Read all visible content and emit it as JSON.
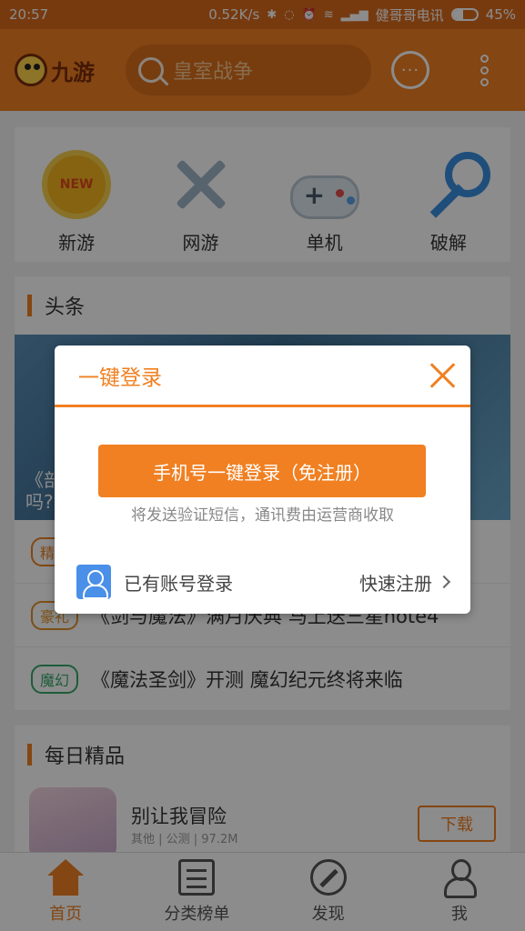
{
  "status_bar": {
    "time": "20:57",
    "speed": "0.52K/s",
    "carrier": "健哥哥电讯",
    "battery": "45%",
    "battery_level": 0.45
  },
  "app_bar": {
    "logo_text": "九游",
    "search_placeholder": "皇室战争",
    "chat_icon": "chat-bubble-icon",
    "more_icon": "more-vertical-icon"
  },
  "categories": [
    {
      "label": "新游",
      "icon": "new-badge-icon",
      "badge": "NEW"
    },
    {
      "label": "网游",
      "icon": "crossed-swords-icon"
    },
    {
      "label": "单机",
      "icon": "gamepad-icon"
    },
    {
      "label": "破解",
      "icon": "key-icon"
    }
  ],
  "headlines": {
    "title": "头条",
    "banner_caption": "《部\n吗?",
    "items": [
      {
        "tag": "精",
        "text": ""
      },
      {
        "tag": "豪礼",
        "text": "《剑与魔法》满月庆典 马上送三星note4"
      },
      {
        "tag": "魔幻",
        "text": "《魔法圣剑》开测 魔幻纪元终将来临"
      }
    ]
  },
  "daily": {
    "title": "每日精品",
    "game_name": "别让我冒险",
    "game_meta": "其他 | 公测 | 97.2M",
    "download": "下载"
  },
  "bottom_nav": [
    {
      "label": "首页",
      "active": true
    },
    {
      "label": "分类榜单",
      "active": false
    },
    {
      "label": "发现",
      "active": false
    },
    {
      "label": "我",
      "active": false
    }
  ],
  "dialog": {
    "title": "一键登录",
    "primary_button": "手机号一键登录（免注册）",
    "note": "将发送验证短信，通讯费由运营商收取",
    "account_login": "已有账号登录",
    "quick_register": "快速注册"
  },
  "colors": {
    "accent": "#f08022",
    "statusbar": "#d96b1c",
    "account_icon": "#4a8fe8"
  }
}
